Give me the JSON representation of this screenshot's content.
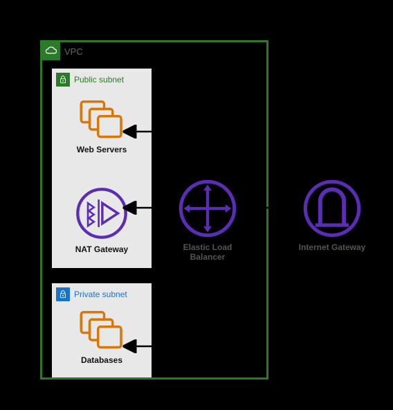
{
  "vpc": {
    "label": "VPC"
  },
  "public_subnet": {
    "title": "Public subnet",
    "web_servers": {
      "label": "Web Servers"
    },
    "nat_gateway": {
      "label": "NAT Gateway"
    }
  },
  "private_subnet": {
    "title": "Private subnet",
    "databases": {
      "label": "Databases"
    }
  },
  "elb": {
    "label": "Elastic Load Balancer"
  },
  "igw": {
    "label": "Internet Gateway"
  },
  "icons": {
    "vpc": "vpc-icon",
    "lock": "lock-icon",
    "instances": "instances-icon",
    "nat": "nat-gateway-icon",
    "elb": "elb-icon",
    "igw": "internet-gateway-icon"
  },
  "colors": {
    "vpc_border": "#2a7a2a",
    "public": "#2a7a2a",
    "private": "#1a73c8",
    "instance": "#d97706",
    "purple": "#5b2db4",
    "subnet_bg": "#e8e8e8"
  }
}
